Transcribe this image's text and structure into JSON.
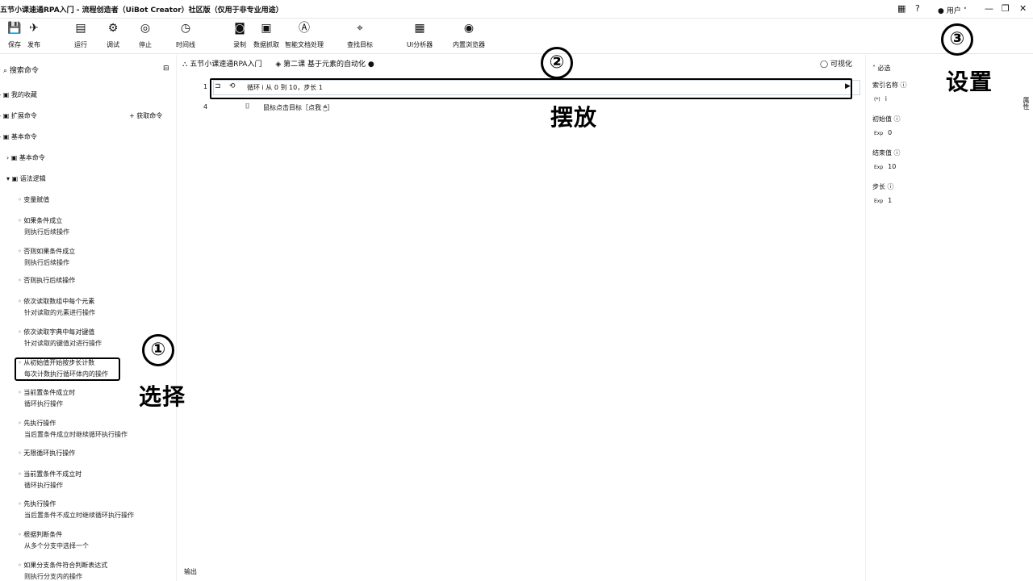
{
  "titlebar": {
    "title": "五节小课速通RPA入门 - 流程创造者（UiBot Creator）社区版（仅用于非专业用途）",
    "help_icon": "?",
    "user": "用户",
    "minimize": "—",
    "restore": "❐",
    "close": "✕"
  },
  "toolbar": [
    {
      "icon": "save-icon",
      "glyph": "💾",
      "label": "保存"
    },
    {
      "icon": "publish-icon",
      "glyph": "✈",
      "label": "发布"
    },
    {
      "icon": "run-icon",
      "glyph": "▤",
      "label": "运行"
    },
    {
      "icon": "debug-icon",
      "glyph": "⚙",
      "label": "调试"
    },
    {
      "icon": "stop-icon",
      "glyph": "◎",
      "label": "停止"
    },
    {
      "icon": "timer-icon",
      "glyph": "◷",
      "label": "时间线"
    },
    {
      "icon": "record-icon",
      "glyph": "◙",
      "label": "录制"
    },
    {
      "icon": "capture-icon",
      "glyph": "▣",
      "label": "数据抓取"
    },
    {
      "icon": "ai-icon",
      "glyph": "Ⓐ",
      "label": "智能文档处理"
    },
    {
      "icon": "find-target-icon",
      "glyph": "⌖",
      "label": "查找目标"
    },
    {
      "icon": "ui-analyzer-icon",
      "glyph": "▦",
      "label": "UI分析器"
    },
    {
      "icon": "browser-selector-icon",
      "glyph": "◉",
      "label": "内置浏览器"
    }
  ],
  "left_panel": {
    "search_placeholder": "搜索命令",
    "tree": [
      {
        "label": "我的收藏",
        "level": 0
      },
      {
        "label": "扩展命令",
        "level": 0,
        "action": "获取命令"
      },
      {
        "label": "基本命令",
        "level": 0
      },
      {
        "label": "基本命令",
        "level": 1
      },
      {
        "label": "语法逻辑",
        "level": 1
      }
    ],
    "items": [
      {
        "title": "变量赋值",
        "desc": ""
      },
      {
        "title": "如果条件成立",
        "desc": "则执行后续操作"
      },
      {
        "title": "否则如果条件成立",
        "desc": "则执行后续操作"
      },
      {
        "title": "否则执行后续操作",
        "desc": ""
      },
      {
        "title": "依次读取数组中每个元素",
        "desc": "针对读取的元素进行操作"
      },
      {
        "title": "依次读取字典中每对键值",
        "desc": "针对读取的键值对进行操作"
      },
      {
        "title": "从初始值开始按步长计数",
        "desc": "每次计数执行循环体内的操作"
      },
      {
        "title": "当前置条件成立时",
        "desc": "循环执行操作"
      },
      {
        "title": "先执行操作",
        "desc": "当后置条件成立时继续循环执行操作"
      },
      {
        "title": "无限循环执行操作",
        "desc": ""
      },
      {
        "title": "当前置条件不成立时",
        "desc": "循环执行操作"
      },
      {
        "title": "先执行操作",
        "desc": "当后置条件不成立时继续循环执行操作"
      },
      {
        "title": "根据判断条件",
        "desc": "从多个分支中选择一个"
      },
      {
        "title": "如果分支条件符合判断表达式",
        "desc": "则执行分支内的操作"
      }
    ]
  },
  "canvas": {
    "breadcrumb_1": "五节小课速通RPA入门",
    "breadcrumb_2": "第二课 基于元素的自动化",
    "visual_toggle": "可视化",
    "rows": [
      {
        "line": "1",
        "text": "循环 i 从 0 到 10，步长 1"
      },
      {
        "line": "4",
        "text": "鼠标点击目标［点我 🖱］"
      }
    ],
    "output_label": "输出"
  },
  "right_panel": {
    "section": "必选",
    "fields": [
      {
        "label": "索引名称",
        "value": "i",
        "prefix": "(*)"
      },
      {
        "label": "初始值",
        "value": "0",
        "prefix": "Exp"
      },
      {
        "label": "结束值",
        "value": "10",
        "prefix": "Exp"
      },
      {
        "label": "步长",
        "value": "1",
        "prefix": "Exp"
      }
    ],
    "side_tab": "属性"
  },
  "annotations": {
    "step1_num": "①",
    "step1_text": "选择",
    "step2_num": "②",
    "step2_text": "摆放",
    "step3_num": "③",
    "step3_text": "设置"
  }
}
